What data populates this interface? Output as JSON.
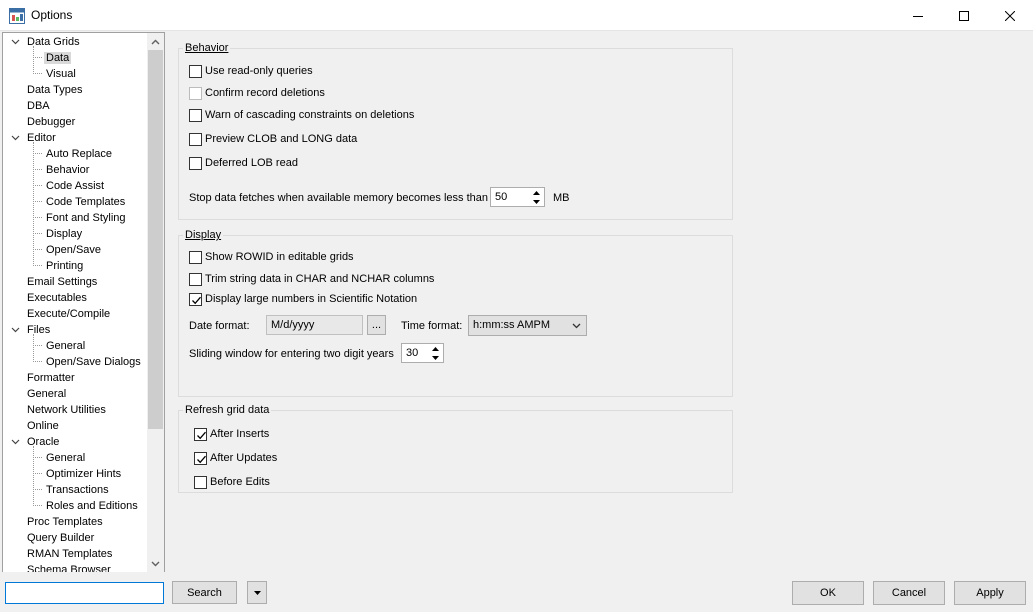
{
  "window": {
    "title": "Options",
    "minimize_icon": "minimize-icon",
    "maximize_icon": "maximize-icon",
    "close_icon": "close-icon"
  },
  "tree": {
    "items": [
      {
        "label": "Data Grids",
        "level": 0,
        "expanded": true
      },
      {
        "label": "Data",
        "level": 1,
        "selected": true
      },
      {
        "label": "Visual",
        "level": 1
      },
      {
        "label": "Data Types",
        "level": 0
      },
      {
        "label": "DBA",
        "level": 0
      },
      {
        "label": "Debugger",
        "level": 0
      },
      {
        "label": "Editor",
        "level": 0,
        "expanded": true
      },
      {
        "label": "Auto Replace",
        "level": 1
      },
      {
        "label": "Behavior",
        "level": 1
      },
      {
        "label": "Code Assist",
        "level": 1
      },
      {
        "label": "Code Templates",
        "level": 1
      },
      {
        "label": "Font and Styling",
        "level": 1
      },
      {
        "label": "Display",
        "level": 1
      },
      {
        "label": "Open/Save",
        "level": 1
      },
      {
        "label": "Printing",
        "level": 1
      },
      {
        "label": "Email Settings",
        "level": 0
      },
      {
        "label": "Executables",
        "level": 0
      },
      {
        "label": "Execute/Compile",
        "level": 0
      },
      {
        "label": "Files",
        "level": 0,
        "expanded": true
      },
      {
        "label": "General",
        "level": 1
      },
      {
        "label": "Open/Save Dialogs",
        "level": 1
      },
      {
        "label": "Formatter",
        "level": 0
      },
      {
        "label": "General",
        "level": 0
      },
      {
        "label": "Network Utilities",
        "level": 0
      },
      {
        "label": "Online",
        "level": 0
      },
      {
        "label": "Oracle",
        "level": 0,
        "expanded": true
      },
      {
        "label": "General",
        "level": 1
      },
      {
        "label": "Optimizer Hints",
        "level": 1
      },
      {
        "label": "Transactions",
        "level": 1
      },
      {
        "label": "Roles and Editions",
        "level": 1
      },
      {
        "label": "Proc Templates",
        "level": 0
      },
      {
        "label": "Query Builder",
        "level": 0
      },
      {
        "label": "RMAN Templates",
        "level": 0
      },
      {
        "label": "Schema Browser",
        "level": 0
      }
    ]
  },
  "behavior": {
    "title": "Behavior",
    "read_only": {
      "label": "Use read-only queries",
      "checked": false
    },
    "confirm_delete": {
      "label": "Confirm record deletions",
      "checked": false,
      "disabled": true
    },
    "warn_cascade": {
      "label": "Warn of cascading constraints on deletions",
      "checked": false
    },
    "preview_clob": {
      "label": "Preview CLOB and LONG data",
      "checked": false
    },
    "deferred_lob": {
      "label": "Deferred LOB read",
      "checked": false
    },
    "memory_label": "Stop data fetches when available memory becomes less than",
    "memory_value": "50",
    "memory_unit": "MB"
  },
  "display": {
    "title": "Display",
    "show_rowid": {
      "label": "Show ROWID in editable grids",
      "checked": false
    },
    "trim_string": {
      "label": "Trim string data in CHAR and NCHAR columns",
      "checked": false
    },
    "sci_notation": {
      "label": "Display large numbers in Scientific Notation",
      "checked": true
    },
    "date_format_label": "Date format:",
    "date_format_value": "M/d/yyyy",
    "ellipsis_label": "...",
    "time_format_label": "Time format:",
    "time_format_value": "h:mm:ss AMPM",
    "sliding_label": "Sliding window for entering two digit years",
    "sliding_value": "30"
  },
  "refresh": {
    "title": "Refresh grid data",
    "after_inserts": {
      "label": "After Inserts",
      "checked": true
    },
    "after_updates": {
      "label": "After Updates",
      "checked": true
    },
    "before_edits": {
      "label": "Before Edits",
      "checked": false
    }
  },
  "bottom": {
    "search_value": "",
    "search_button": "Search",
    "ok": "OK",
    "cancel": "Cancel",
    "apply": "Apply"
  },
  "colors": {
    "accent": "#0078d7",
    "selection": "#d9d9d9"
  }
}
